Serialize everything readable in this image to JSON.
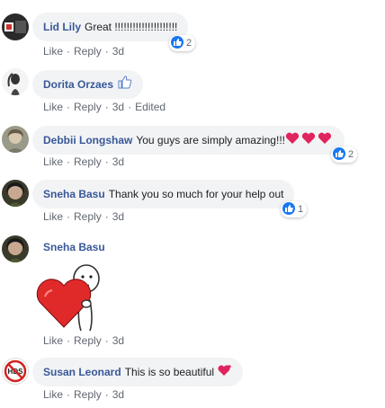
{
  "comments": [
    {
      "author": "Lid Lily",
      "text": "Great !!!!!!!!!!!!!!!!!!!!!",
      "actions": {
        "like": "Like",
        "reply": "Reply",
        "time": "3d"
      },
      "reactions": "2"
    },
    {
      "author": "Dorita Orzaes",
      "text": "",
      "actions": {
        "like": "Like",
        "reply": "Reply",
        "time": "3d",
        "edited": "Edited"
      }
    },
    {
      "author": "Debbii Longshaw",
      "text": "You guys are simply amazing!!!",
      "actions": {
        "like": "Like",
        "reply": "Reply",
        "time": "3d"
      },
      "reactions": "2"
    },
    {
      "author": "Sneha Basu",
      "text": "Thank you so much for your help out",
      "actions": {
        "like": "Like",
        "reply": "Reply",
        "time": "3d"
      },
      "reactions": "1"
    },
    {
      "author": "Sneha Basu",
      "text": "",
      "actions": {
        "like": "Like",
        "reply": "Reply",
        "time": "3d"
      }
    },
    {
      "author": "Susan Leonard",
      "text": "This is so beautiful",
      "actions": {
        "like": "Like",
        "reply": "Reply",
        "time": "3d"
      }
    }
  ],
  "colors": {
    "author": "#385898",
    "like_badge": "#1877f2",
    "heart": "#e0245e",
    "bubble_bg": "#f2f3f5",
    "meta_text": "#606770"
  },
  "icons": {
    "thumb": "thumbs-up-icon",
    "heart": "heart-icon",
    "sticker": "heart-hug-sticker"
  }
}
